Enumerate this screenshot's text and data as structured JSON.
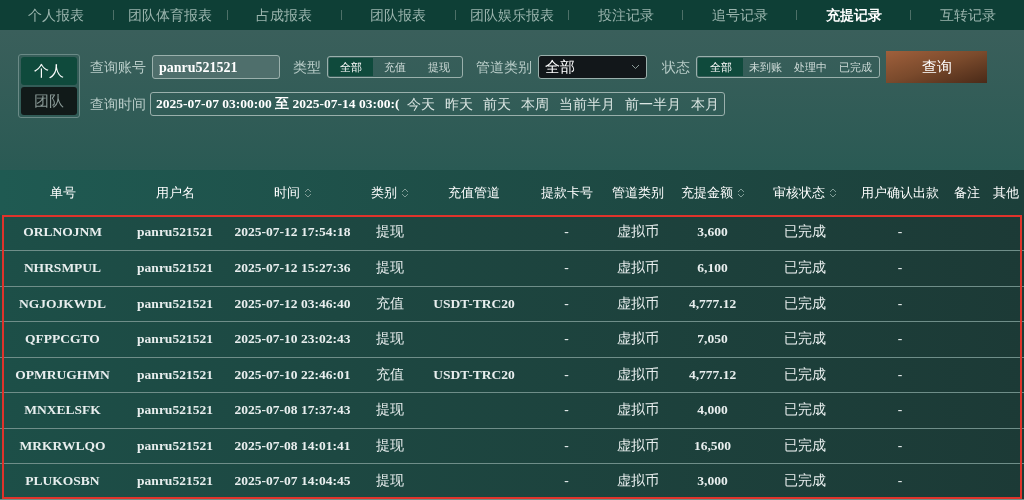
{
  "nav_tabs": [
    {
      "label": "个人报表",
      "selected": false
    },
    {
      "label": "团队体育报表",
      "selected": false
    },
    {
      "label": "占成报表",
      "selected": false
    },
    {
      "label": "团队报表",
      "selected": false
    },
    {
      "label": "团队娱乐报表",
      "selected": false
    },
    {
      "label": "投注记录",
      "selected": false
    },
    {
      "label": "追号记录",
      "selected": false
    },
    {
      "label": "充提记录",
      "selected": true
    },
    {
      "label": "互转记录",
      "selected": false
    }
  ],
  "scope_toggle": [
    {
      "label": "个人",
      "selected": true
    },
    {
      "label": "团队",
      "selected": false
    }
  ],
  "filters": {
    "account_label": "查询账号",
    "account_value": "panru521521",
    "type_label": "类型",
    "type_options": [
      {
        "label": "全部",
        "selected": true
      },
      {
        "label": "充值",
        "selected": false
      },
      {
        "label": "提现",
        "selected": false
      }
    ],
    "channel_label": "管道类别",
    "channel_value": "全部",
    "status_label": "状态",
    "status_options": [
      {
        "label": "全部",
        "selected": true
      },
      {
        "label": "未到账",
        "selected": false
      },
      {
        "label": "处理中",
        "selected": false
      },
      {
        "label": "已完成",
        "selected": false
      }
    ],
    "query_button": "查询",
    "time_label": "查询时间",
    "time_value": "2025-07-07 03:00:00 至 2025-07-14 03:00:(",
    "quick_ranges": [
      "今天",
      "昨天",
      "前天",
      "本周",
      "当前半月",
      "前一半月",
      "本月"
    ]
  },
  "table": {
    "columns": [
      {
        "label": "单号",
        "sortable": false
      },
      {
        "label": "用户名",
        "sortable": false
      },
      {
        "label": "时间",
        "sortable": true
      },
      {
        "label": "类别",
        "sortable": true
      },
      {
        "label": "充值管道",
        "sortable": false
      },
      {
        "label": "提款卡号",
        "sortable": false
      },
      {
        "label": "管道类别",
        "sortable": false
      },
      {
        "label": "充提金额",
        "sortable": true
      },
      {
        "label": "审核状态",
        "sortable": true
      },
      {
        "label": "用户确认出款",
        "sortable": false
      },
      {
        "label": "备注",
        "sortable": false
      },
      {
        "label": "其他",
        "sortable": false
      }
    ],
    "rows": [
      [
        "ORLNOJNM",
        "panru521521",
        "2025-07-12 17:54:18",
        "提现",
        "",
        "-",
        "虚拟币",
        "3,600",
        "已完成",
        "-"
      ],
      [
        "NHRSMPUL",
        "panru521521",
        "2025-07-12 15:27:36",
        "提现",
        "",
        "-",
        "虚拟币",
        "6,100",
        "已完成",
        "-"
      ],
      [
        "NGJOJKWDL",
        "panru521521",
        "2025-07-12 03:46:40",
        "充值",
        "USDT-TRC20",
        "-",
        "虚拟币",
        "4,777.12",
        "已完成",
        "-"
      ],
      [
        "QFPPCGTO",
        "panru521521",
        "2025-07-10 23:02:43",
        "提现",
        "",
        "-",
        "虚拟币",
        "7,050",
        "已完成",
        "-"
      ],
      [
        "OPMRUGHMN",
        "panru521521",
        "2025-07-10 22:46:01",
        "充值",
        "USDT-TRC20",
        "-",
        "虚拟币",
        "4,777.12",
        "已完成",
        "-"
      ],
      [
        "MNXELSFK",
        "panru521521",
        "2025-07-08 17:37:43",
        "提现",
        "",
        "-",
        "虚拟币",
        "4,000",
        "已完成",
        "-"
      ],
      [
        "MRKRWLQO",
        "panru521521",
        "2025-07-08 14:01:41",
        "提现",
        "",
        "-",
        "虚拟币",
        "16,500",
        "已完成",
        "-"
      ],
      [
        "PLUKOSBN",
        "panru521521",
        "2025-07-07 14:04:45",
        "提现",
        "",
        "-",
        "虚拟币",
        "3,000",
        "已完成",
        "-"
      ]
    ]
  }
}
